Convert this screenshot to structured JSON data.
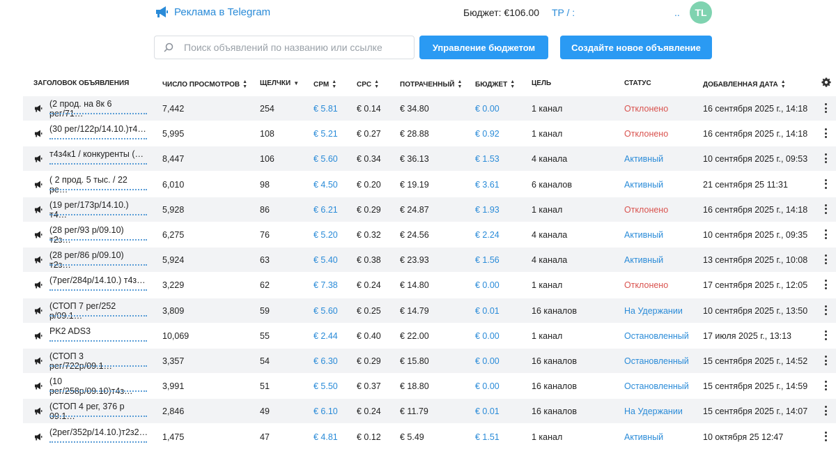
{
  "header": {
    "title": "Реклама в Telegram",
    "budget_label": "Бюджет: €106.00",
    "account_label": "TP / :",
    "account_menu": "..",
    "avatar": "TL"
  },
  "toolbar": {
    "search_placeholder": "Поиск объявлений по названию или ссылке",
    "budget_button": "Управление бюджетом",
    "create_button": "Создайте новое объявление"
  },
  "table": {
    "columns": {
      "title": "ЗАГОЛОВОК ОБЪЯВЛЕНИЯ",
      "views": "ЧИСЛО ПРОСМОТРОВ",
      "clicks": "ЩЕЛЧКИ",
      "cpm": "CPM",
      "cpc": "CPC",
      "spent": "ПОТРАЧЕННЫЙ",
      "budget": "БЮДЖЕТ",
      "target": "ЦЕЛЬ",
      "status": "СТАТУС",
      "date": "ДОБАВЛЕННАЯ ДАТА"
    },
    "rows": [
      {
        "title": "(2 прод. на 8к 6 рег/71…",
        "views": "7,442",
        "clicks": "254",
        "cpm": "€ 5.81",
        "cpc": "€ 0.14",
        "spent": "€ 34.80",
        "budget": "€ 0.00",
        "target": "1 канал",
        "status": "Отклонено",
        "status_kind": "rejected",
        "date": "16 сентября 2025 г., 14:18"
      },
      {
        "title": "(30 рег/122р/14.10.)т4…",
        "views": "5,995",
        "clicks": "108",
        "cpm": "€ 5.21",
        "cpc": "€ 0.27",
        "spent": "€ 28.88",
        "budget": "€ 0.92",
        "target": "1 канал",
        "status": "Отклонено",
        "status_kind": "rejected",
        "date": "16 сентября 2025 г., 14:18"
      },
      {
        "title": "т4з4к1 / конкуренты (…",
        "views": "8,447",
        "clicks": "106",
        "cpm": "€ 5.60",
        "cpc": "€ 0.34",
        "spent": "€ 36.13",
        "budget": "€ 1.53",
        "target": "4 канала",
        "status": "Активный",
        "status_kind": "active",
        "date": "10 сентября 2025 г., 09:53"
      },
      {
        "title": "( 2 прод. 5 тыс. / 22 ре…",
        "views": "6,010",
        "clicks": "98",
        "cpm": "€ 4.50",
        "cpc": "€ 0.20",
        "spent": "€ 19.19",
        "budget": "€ 3.61",
        "target": "6 каналов",
        "status": "Активный",
        "status_kind": "active",
        "date": "21 сентября 25 11:31"
      },
      {
        "title": "(19 рег/173р/14.10.) т4…",
        "views": "5,928",
        "clicks": "86",
        "cpm": "€ 6.21",
        "cpc": "€ 0.29",
        "spent": "€ 24.87",
        "budget": "€ 1.93",
        "target": "1 канал",
        "status": "Отклонено",
        "status_kind": "rejected",
        "date": "16 сентября 2025 г., 14:18"
      },
      {
        "title": "(28 рег/93 р/09.10) т2з…",
        "views": "6,275",
        "clicks": "76",
        "cpm": "€ 5.20",
        "cpc": "€ 0.32",
        "spent": "€ 24.56",
        "budget": "€ 2.24",
        "target": "4 канала",
        "status": "Активный",
        "status_kind": "active",
        "date": "10 сентября 2025 г., 09:35"
      },
      {
        "title": "(28 рег/86 р/09.10) т2з…",
        "views": "5,924",
        "clicks": "63",
        "cpm": "€ 5.40",
        "cpc": "€ 0.38",
        "spent": "€ 23.93",
        "budget": "€ 1.56",
        "target": "4 канала",
        "status": "Активный",
        "status_kind": "active",
        "date": "13 сентября 2025 г., 10:08"
      },
      {
        "title": "(7рег/284р/14.10.) т4з…",
        "views": "3,229",
        "clicks": "62",
        "cpm": "€ 7.38",
        "cpc": "€ 0.24",
        "spent": "€ 14.80",
        "budget": "€ 0.00",
        "target": "1 канал",
        "status": "Отклонено",
        "status_kind": "rejected",
        "date": "17 сентября 2025 г., 12:05"
      },
      {
        "title": "(СТОП 7 рег/252 р/09.1…",
        "views": "3,809",
        "clicks": "59",
        "cpm": "€ 5.60",
        "cpc": "€ 0.25",
        "spent": "€ 14.79",
        "budget": "€ 0.01",
        "target": "16 каналов",
        "status": "На Удержании",
        "status_kind": "hold",
        "date": "10 сентября 2025 г., 13:50"
      },
      {
        "title": "PK2 ADS3",
        "views": "10,069",
        "clicks": "55",
        "cpm": "€ 2.44",
        "cpc": "€ 0.40",
        "spent": "€ 22.00",
        "budget": "€ 0.00",
        "target": "1 канал",
        "status": "Остановленный",
        "status_kind": "stopped",
        "date": "17 июля 2025 г., 13:13"
      },
      {
        "title": "(СТОП 3 рег/722р/09.1…",
        "views": "3,357",
        "clicks": "54",
        "cpm": "€ 6.30",
        "cpc": "€ 0.29",
        "spent": "€ 15.80",
        "budget": "€ 0.00",
        "target": "16 каналов",
        "status": "Остановленный",
        "status_kind": "stopped",
        "date": "15 сентября 2025 г., 14:52"
      },
      {
        "title": "(10 рег/258р/09.10)т4з…",
        "views": "3,991",
        "clicks": "51",
        "cpm": "€ 5.50",
        "cpc": "€ 0.37",
        "spent": "€ 18.80",
        "budget": "€ 0.00",
        "target": "16 каналов",
        "status": "Остановленный",
        "status_kind": "stopped",
        "date": "15 сентября 2025 г., 14:59"
      },
      {
        "title": "(СТОП 4 рег, 376 р 09.1…",
        "views": "2,846",
        "clicks": "49",
        "cpm": "€ 6.10",
        "cpc": "€ 0.24",
        "spent": "€ 11.79",
        "budget": "€ 0.01",
        "target": "16 каналов",
        "status": "На Удержании",
        "status_kind": "hold",
        "date": "15 сентября 2025 г., 14:07"
      },
      {
        "title": "(2рег/352р/14.10.)т2з2…",
        "views": "1,475",
        "clicks": "47",
        "cpm": "€ 4.81",
        "cpc": "€ 0.12",
        "spent": "€ 5.49",
        "budget": "€ 1.51",
        "target": "1 канал",
        "status": "Активный",
        "status_kind": "active",
        "date": "10 октября 25 12:47"
      }
    ]
  },
  "colors": {
    "accent": "#2a9af3",
    "link": "#2a8bd8",
    "rejected": "#d9534f",
    "row_shade": "#f2f3f5",
    "avatar": "#7fd3b0"
  },
  "icons": {
    "brand": "megaphone-icon",
    "search": "search-icon",
    "settings": "gear-icon",
    "row": "megaphone-icon",
    "row_menu": "kebab-menu-icon"
  }
}
